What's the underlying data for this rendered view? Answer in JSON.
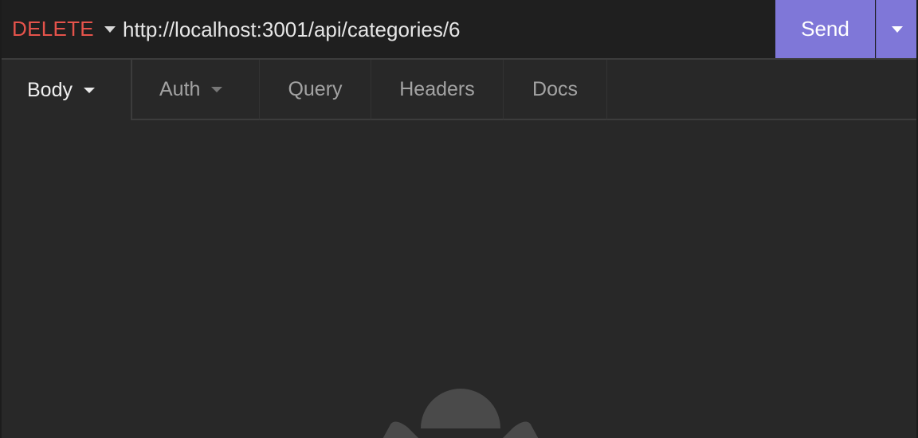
{
  "request": {
    "method": "DELETE",
    "url": "http://localhost:3001/api/categories/6",
    "method_color": "#e5534b"
  },
  "send": {
    "label": "Send",
    "color": "#7f77d8"
  },
  "tabs": [
    {
      "label": "Body",
      "active": true,
      "has_dropdown": true
    },
    {
      "label": "Auth",
      "active": false,
      "has_dropdown": true
    },
    {
      "label": "Query",
      "active": false,
      "has_dropdown": false
    },
    {
      "label": "Headers",
      "active": false,
      "has_dropdown": false
    },
    {
      "label": "Docs",
      "active": false,
      "has_dropdown": false
    }
  ],
  "icons": {
    "method_dropdown": "chevron-down-icon",
    "send_dropdown": "chevron-down-icon",
    "empty_state": "empty-state-icon"
  }
}
